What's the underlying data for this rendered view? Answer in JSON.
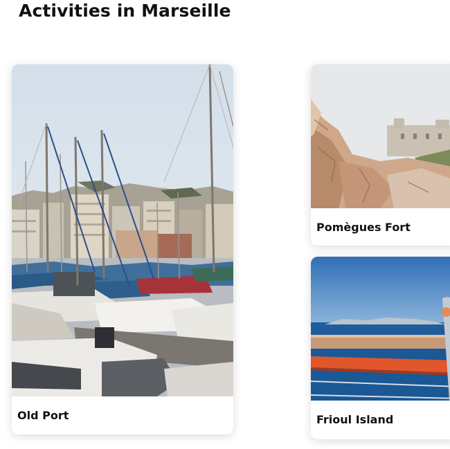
{
  "page": {
    "title": "Activities in Marseille"
  },
  "activities": [
    {
      "label": "Old Port",
      "image": "marina-boats-photo"
    },
    {
      "label": "Pomègues Fort",
      "image": "rocky-fort-photo"
    },
    {
      "label": "Frioul Island",
      "image": "sea-island-view-photo"
    }
  ]
}
